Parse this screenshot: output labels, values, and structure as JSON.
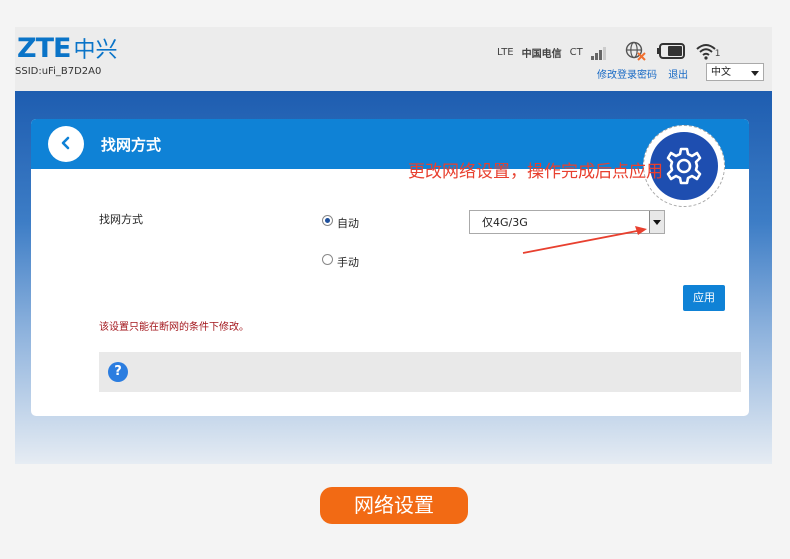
{
  "header": {
    "logo_text": "ZTE",
    "logo_cn": "中兴",
    "ssid": "SSID:uFi_B7D2A0",
    "network_type": "LTE",
    "carrier": "中国电信",
    "carrier_short": "CT",
    "wifi_clients": "1",
    "links": {
      "change_password": "修改登录密码",
      "logout": "退出"
    },
    "language": "中文"
  },
  "card": {
    "title": "找网方式",
    "field_label": "找网方式",
    "options": [
      {
        "label": "自动",
        "selected": true
      },
      {
        "label": "手动",
        "selected": false
      }
    ],
    "select_value": "仅4G/3G",
    "apply_label": "应用",
    "note": "该设置只能在断网的条件下修改。",
    "help_symbol": "?"
  },
  "annotation": {
    "text": "更改网络设置，操作完成后点应用",
    "color": "#e8402f"
  },
  "caption": "网络设置",
  "colors": {
    "brand_blue": "#0a74c8",
    "header_blue": "#0f82d6",
    "caption_orange": "#f26a14",
    "note_red": "#a3171d"
  },
  "icons": [
    "back-icon",
    "gear-icon",
    "signal-icon",
    "globe-icon",
    "battery-icon",
    "wifi-icon",
    "help-icon"
  ]
}
